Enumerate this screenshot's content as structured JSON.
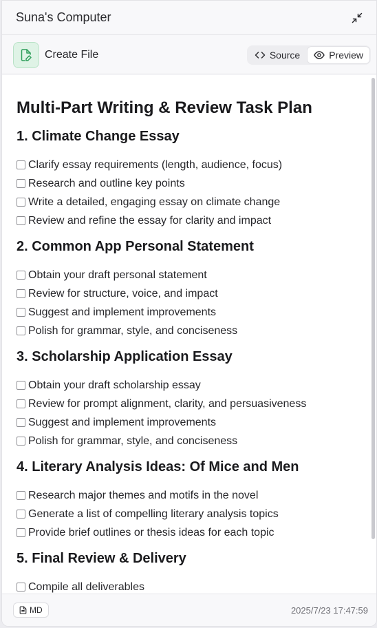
{
  "window": {
    "title": "Suna's Computer"
  },
  "toolbar": {
    "tool_label": "Create File",
    "tabs": [
      {
        "label": "Source",
        "icon": "code-icon",
        "active": false
      },
      {
        "label": "Preview",
        "icon": "eye-icon",
        "active": true
      }
    ]
  },
  "document": {
    "title": "Multi-Part Writing & Review Task Plan",
    "sections": [
      {
        "heading": "1. Climate Change Essay",
        "tasks": [
          "Clarify essay requirements (length, audience, focus)",
          "Research and outline key points",
          "Write a detailed, engaging essay on climate change",
          "Review and refine the essay for clarity and impact"
        ]
      },
      {
        "heading": "2. Common App Personal Statement",
        "tasks": [
          "Obtain your draft personal statement",
          "Review for structure, voice, and impact",
          "Suggest and implement improvements",
          "Polish for grammar, style, and conciseness"
        ]
      },
      {
        "heading": "3. Scholarship Application Essay",
        "tasks": [
          "Obtain your draft scholarship essay",
          "Review for prompt alignment, clarity, and persuasiveness",
          "Suggest and implement improvements",
          "Polish for grammar, style, and conciseness"
        ]
      },
      {
        "heading": "4. Literary Analysis Ideas: Of Mice and Men",
        "tasks": [
          "Research major themes and motifs in the novel",
          "Generate a list of compelling literary analysis topics",
          "Provide brief outlines or thesis ideas for each topic"
        ]
      },
      {
        "heading": "5. Final Review & Delivery",
        "tasks": [
          "Compile all deliverables"
        ]
      }
    ]
  },
  "footer": {
    "format_badge": "MD",
    "timestamp": "2025/7/23 17:47:59"
  },
  "colors": {
    "accent_green": "#2f9e5b",
    "accent_green_bg": "#dff3e6"
  }
}
